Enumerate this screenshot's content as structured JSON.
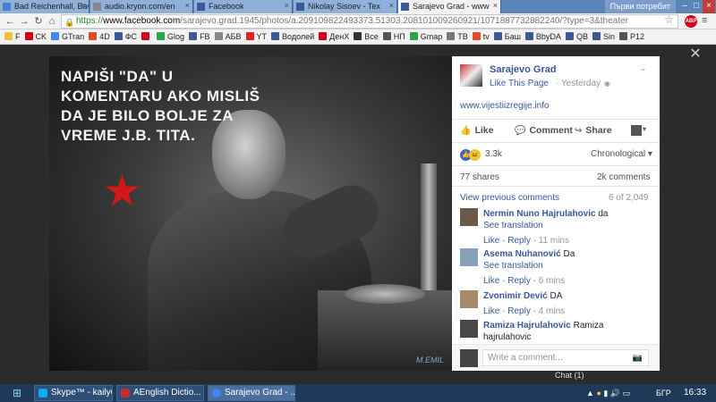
{
  "browser": {
    "tabs": [
      {
        "title": "Bad Reichenhall, Bav",
        "color": "#4a7fd6"
      },
      {
        "title": "audio.kryon.com/en",
        "color": "#888888"
      },
      {
        "title": "Facebook",
        "color": "#3b5998"
      },
      {
        "title": "Nikolay Sisoev - Tex",
        "color": "#3b5998"
      },
      {
        "title": "Sarajevo Grad - www",
        "color": "#3b5998"
      }
    ],
    "profile_label": "Първи потребит",
    "url": {
      "proto": "https://",
      "host": "www.facebook.com",
      "path": "/sarajevo.grad.1945/photos/a.209109822493373.51303.208101009260921/1071887732882240/?type=3&theater"
    },
    "bookmarks": [
      {
        "label": "F",
        "color": "#f0c040"
      },
      {
        "label": "CK",
        "color": "#d0021b"
      },
      {
        "label": "GTran",
        "color": "#4285f4"
      },
      {
        "label": "4D",
        "color": "#e04b2b"
      },
      {
        "label": "ФС",
        "color": "#3b5998"
      },
      {
        "label": "",
        "color": "#d0021b"
      },
      {
        "label": "Glog",
        "color": "#2aa845"
      },
      {
        "label": "FB",
        "color": "#3b5998"
      },
      {
        "label": "АБВ",
        "color": "#888888"
      },
      {
        "label": "YT",
        "color": "#e62117"
      },
      {
        "label": "Водолей",
        "color": "#3b5998"
      },
      {
        "label": "ДенХ",
        "color": "#d0021b"
      },
      {
        "label": "Все",
        "color": "#333333"
      },
      {
        "label": "НП",
        "color": "#555555"
      },
      {
        "label": "Gmap",
        "color": "#2aa845"
      },
      {
        "label": "ТВ",
        "color": "#777777"
      },
      {
        "label": "tv",
        "color": "#e04b2b"
      },
      {
        "label": "Баш",
        "color": "#3b5998"
      },
      {
        "label": "BbyDA",
        "color": "#3b5998"
      },
      {
        "label": "QB",
        "color": "#3b5998"
      },
      {
        "label": "Sin",
        "color": "#3b5998"
      },
      {
        "label": "P12",
        "color": "#555555"
      }
    ]
  },
  "photo": {
    "caption_lines": [
      "NAPIŠI \"DA\" U",
      "KOMENTARU AKO MISLIŠ",
      "DA JE BILO BOLJE ZA",
      "VREME J.B. TITA."
    ],
    "watermark": "M.EMIL"
  },
  "post": {
    "page_name": "Sarajevo Grad",
    "like_page": "Like This Page",
    "time": "· Yesterday ·",
    "link": "www.vijestiizregije.info",
    "actions": {
      "like": "Like",
      "comment": "Comment",
      "share": "Share"
    },
    "reaction_count": "3.3k",
    "sort": "Chronological",
    "shares": "77 shares",
    "comments_total": "2k comments",
    "view_previous": "View previous comments",
    "counter": "6 of 2,049",
    "comments": [
      {
        "author": "Nermin Nuno Hajrulahovic",
        "text": "da",
        "translate": "See translation",
        "like": "Like",
        "reply": "Reply",
        "time": "11 mins",
        "avatar_color": "#6b5a4a"
      },
      {
        "author": "Asema Nuhanović",
        "text": "Da",
        "translate": "See translation",
        "like": "Like",
        "reply": "Reply",
        "time": "6 mins",
        "avatar_color": "#8aa0b8"
      },
      {
        "author": "Zvonimir Dević",
        "text": "DA",
        "translate": "",
        "like": "Like",
        "reply": "Reply",
        "time": "4 mins",
        "avatar_color": "#a88a6a"
      },
      {
        "author": "Ramiza Hajrulahovic",
        "text": "Ramiza hajrulahovic",
        "translate": "",
        "like": "",
        "reply": "",
        "time": "",
        "avatar_color": "#4a4a4a"
      }
    ],
    "reply_placeholder": "Write a comment..."
  },
  "chat_hint": "Chat (1)",
  "taskbar": {
    "items": [
      {
        "label": "Skype™ - kaily6",
        "color": "#00aff0"
      },
      {
        "label": "AEnglish Dictio...",
        "color": "#c03030"
      },
      {
        "label": "Sarajevo Grad - ...",
        "color": "#4285f4"
      }
    ],
    "lang": "БГР",
    "clock": "16:33"
  }
}
